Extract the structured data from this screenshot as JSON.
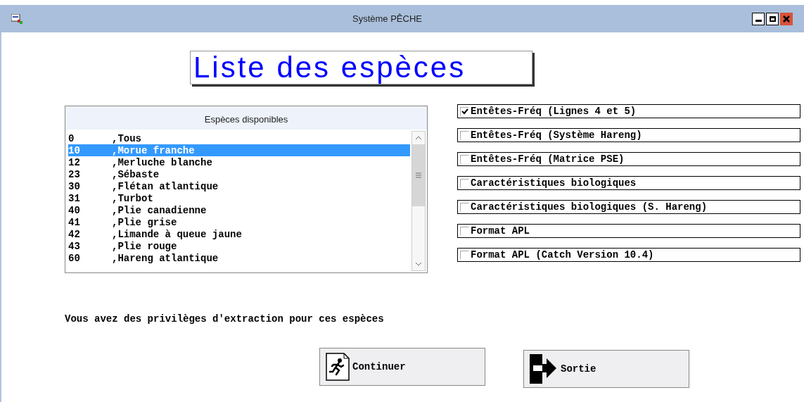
{
  "window": {
    "title": "Système PÊCHE"
  },
  "heading": "Liste des espèces",
  "species_list": {
    "header": "Espèces disponibles",
    "rows": [
      {
        "code": "0",
        "name": ",Tous",
        "selected": false
      },
      {
        "code": "10",
        "name": ",Morue franche",
        "selected": true
      },
      {
        "code": "12",
        "name": ",Merluche blanche",
        "selected": false
      },
      {
        "code": "23",
        "name": ",Sébaste",
        "selected": false
      },
      {
        "code": "30",
        "name": ",Flétan atlantique",
        "selected": false
      },
      {
        "code": "31",
        "name": ",Turbot",
        "selected": false
      },
      {
        "code": "40",
        "name": ",Plie canadienne",
        "selected": false
      },
      {
        "code": "41",
        "name": ",Plie grise",
        "selected": false
      },
      {
        "code": "42",
        "name": ",Limande à queue jaune",
        "selected": false
      },
      {
        "code": "43",
        "name": ",Plie rouge",
        "selected": false
      },
      {
        "code": "60",
        "name": ",Hareng atlantique",
        "selected": false
      }
    ]
  },
  "options": [
    {
      "label": "Entêtes-Fréq (Lignes 4 et 5)",
      "checked": true
    },
    {
      "label": "Entêtes-Fréq (Système Hareng)",
      "checked": false
    },
    {
      "label": "Entêtes-Fréq (Matrice PSE)",
      "checked": false
    },
    {
      "label": "Caractéristiques biologiques",
      "checked": false
    },
    {
      "label": "Caractéristiques biologiques (S. Hareng)",
      "checked": false
    },
    {
      "label": "Format APL",
      "checked": false
    },
    {
      "label": "Format APL (Catch Version 10.4)",
      "checked": false
    }
  ],
  "message": "Vous avez des privilèges d'extraction pour ces espèces",
  "buttons": [
    {
      "label": "Continuer",
      "kind": "continue"
    },
    {
      "label": "Sortie",
      "kind": "exit"
    }
  ]
}
